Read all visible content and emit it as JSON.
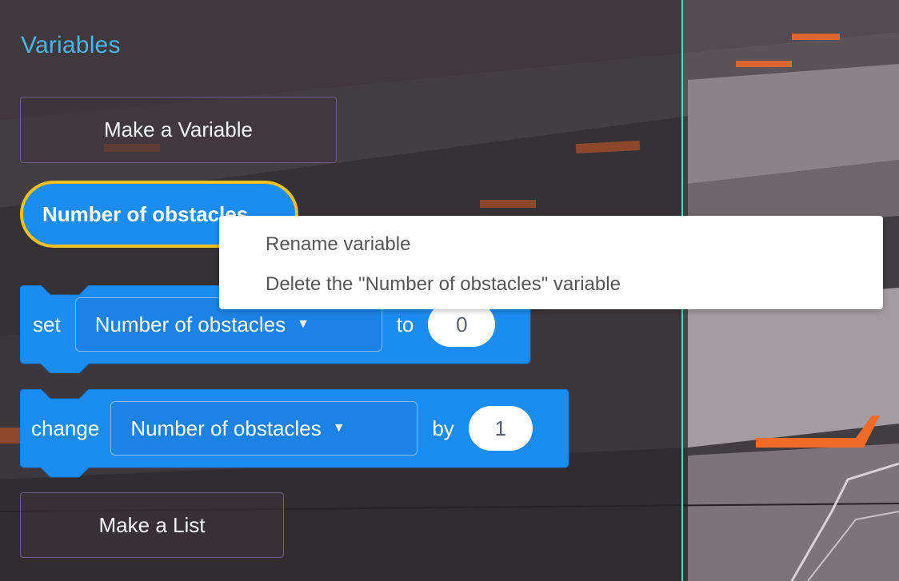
{
  "flyout": {
    "category_title": "Variables",
    "make_variable_label": "Make a Variable",
    "make_list_label": "Make a List",
    "variable_reporter": "Number of obstacles"
  },
  "blocks": {
    "set_block": {
      "keyword": "set",
      "variable": "Number of obstacles",
      "connector": "to",
      "value": "0"
    },
    "change_block": {
      "keyword": "change",
      "variable": "Number of obstacles",
      "connector": "by",
      "value": "1"
    }
  },
  "context_menu": {
    "items": [
      "Rename variable",
      "Delete the \"Number of obstacles\" variable"
    ]
  },
  "colors": {
    "category_title": "#4cb4e7",
    "block_blue": "#1d8cf0",
    "highlight_outline": "#f0c020",
    "stage_divider": "#5fd2bf"
  },
  "icons": {
    "dropdown": "caret-down-icon"
  }
}
